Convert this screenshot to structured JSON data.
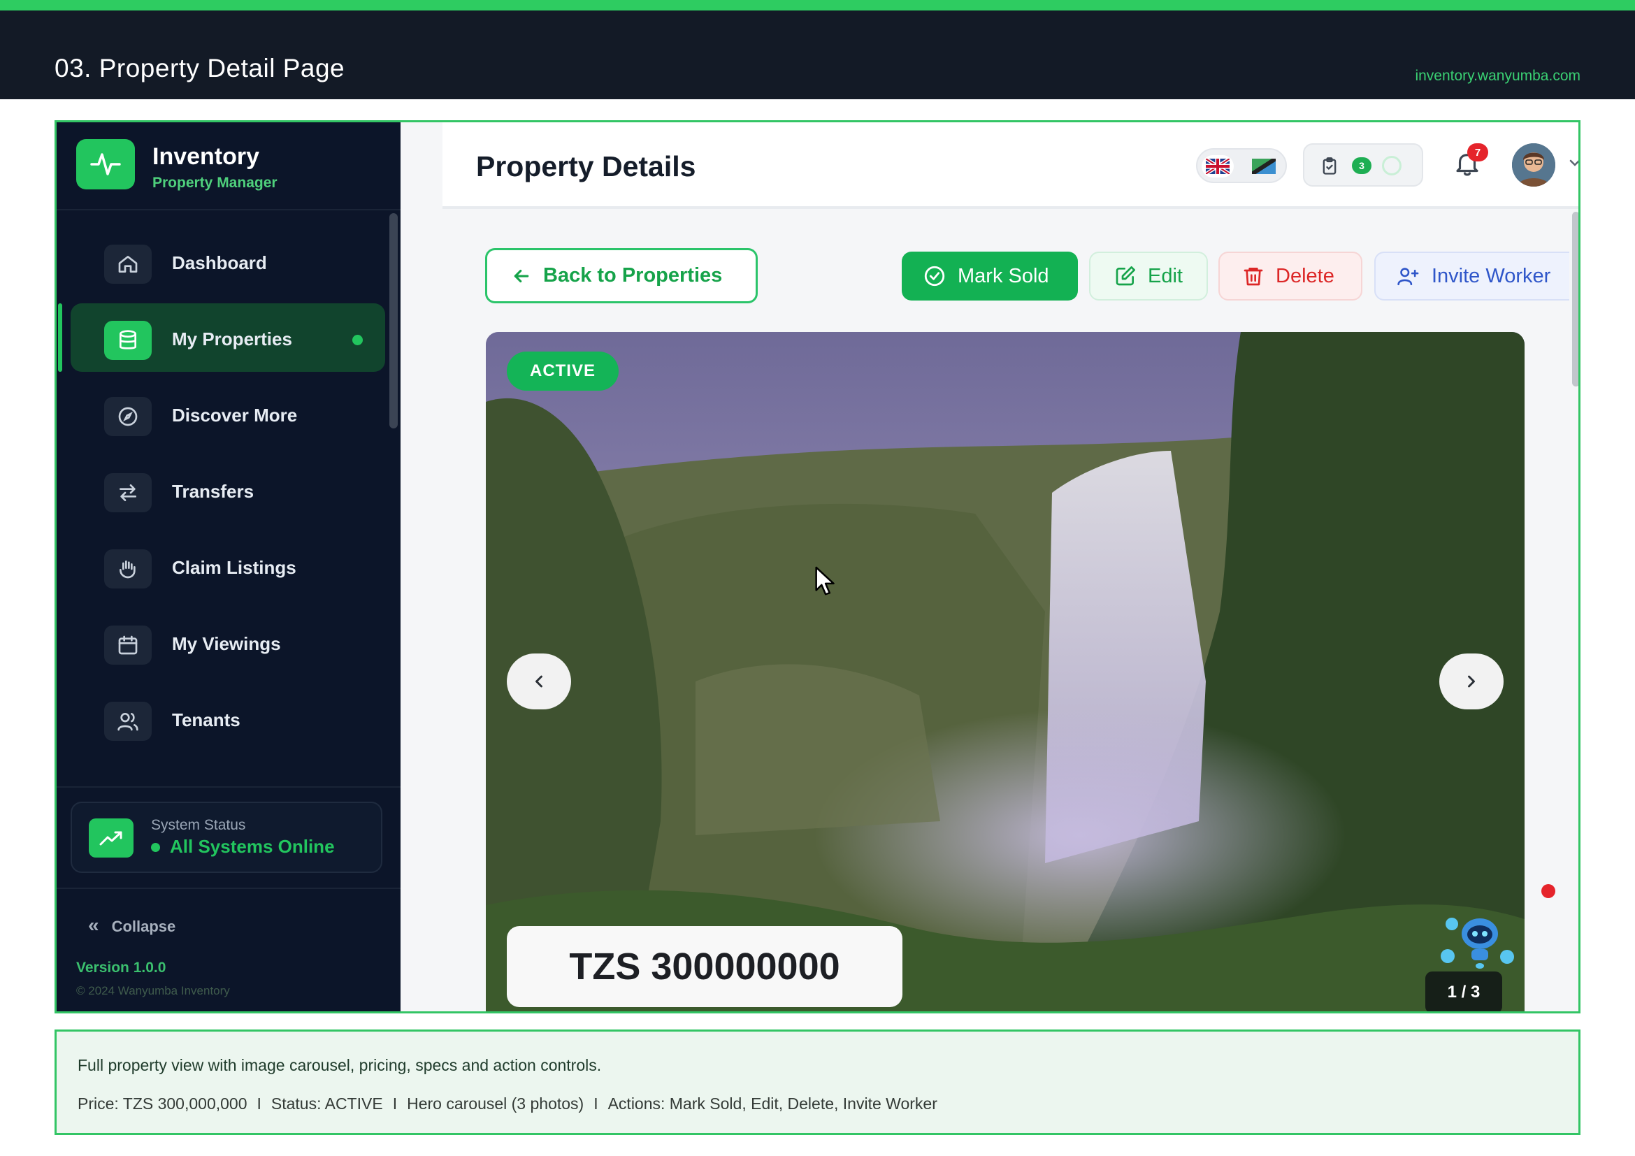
{
  "top_bar": {
    "page_title": "03. Property Detail Page",
    "site_url": "inventory.wanyumba.com",
    "accent_color": "#2ecc61"
  },
  "sidebar": {
    "brand_name": "Inventory",
    "brand_sub": "Property Manager",
    "items": [
      {
        "label": "Dashboard",
        "icon": "home-icon",
        "active": false
      },
      {
        "label": "My Properties",
        "icon": "database-icon",
        "active": true
      },
      {
        "label": "Discover More",
        "icon": "compass-icon",
        "active": false
      },
      {
        "label": "Transfers",
        "icon": "arrows-exchange-icon",
        "active": false
      },
      {
        "label": "Claim Listings",
        "icon": "hand-icon",
        "active": false
      },
      {
        "label": "My Viewings",
        "icon": "calendar-icon",
        "active": false
      },
      {
        "label": "Tenants",
        "icon": "users-icon",
        "active": false
      }
    ],
    "status_title": "System Status",
    "status_value": "All Systems Online",
    "collapse_label": "Collapse",
    "version": "Version 1.0.0",
    "copyright": "© 2024 Wanyumba Inventory"
  },
  "header": {
    "title": "Property Details",
    "task_count": "3",
    "notification_count": "7"
  },
  "actions": {
    "back_label": "Back to Properties",
    "mark_sold_label": "Mark Sold",
    "edit_label": "Edit",
    "delete_label": "Delete",
    "invite_label": "Invite Worker"
  },
  "hero": {
    "status_badge": "ACTIVE",
    "price": "TZS 300000000",
    "counter": "1 / 3"
  },
  "caption": {
    "line1": "Full property view with image carousel, pricing, specs and action controls.",
    "parts": [
      "Price: TZS 300,000,000",
      "Status: ACTIVE",
      "Hero carousel (3 photos)",
      "Actions: Mark Sold, Edit, Delete, Invite Worker"
    ],
    "separator": "I"
  }
}
